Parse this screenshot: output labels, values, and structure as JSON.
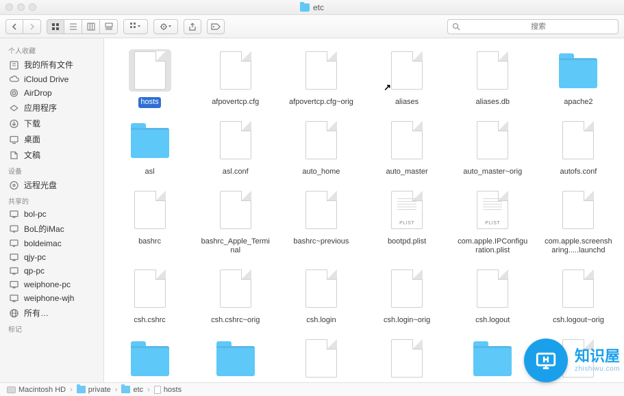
{
  "window": {
    "title": "etc"
  },
  "toolbar": {
    "search_placeholder": "搜索"
  },
  "sidebar": {
    "sections": [
      {
        "header": "个人收藏",
        "items": [
          {
            "icon": "all-files",
            "label": "我的所有文件"
          },
          {
            "icon": "cloud",
            "label": "iCloud Drive"
          },
          {
            "icon": "airdrop",
            "label": "AirDrop"
          },
          {
            "icon": "apps",
            "label": "应用程序"
          },
          {
            "icon": "download",
            "label": "下载"
          },
          {
            "icon": "desktop",
            "label": "桌面"
          },
          {
            "icon": "documents",
            "label": "文稿"
          }
        ]
      },
      {
        "header": "设备",
        "items": [
          {
            "icon": "disc",
            "label": "远程光盘"
          }
        ]
      },
      {
        "header": "共享的",
        "items": [
          {
            "icon": "pc",
            "label": "bol-pc"
          },
          {
            "icon": "imac",
            "label": "BoL的iMac"
          },
          {
            "icon": "imac",
            "label": "boldeimac"
          },
          {
            "icon": "pc",
            "label": "qjy-pc"
          },
          {
            "icon": "pc",
            "label": "qp-pc"
          },
          {
            "icon": "pc",
            "label": "weiphone-pc"
          },
          {
            "icon": "pc",
            "label": "weiphone-wjh"
          },
          {
            "icon": "globe",
            "label": "所有…"
          }
        ]
      },
      {
        "header": "标记",
        "items": []
      }
    ]
  },
  "files": [
    {
      "name": "hosts",
      "type": "file",
      "selected": true
    },
    {
      "name": "afpovertcp.cfg",
      "type": "file"
    },
    {
      "name": "afpovertcp.cfg~orig",
      "type": "file"
    },
    {
      "name": "aliases",
      "type": "file",
      "alias": true
    },
    {
      "name": "aliases.db",
      "type": "file"
    },
    {
      "name": "apache2",
      "type": "folder"
    },
    {
      "name": "asl",
      "type": "folder"
    },
    {
      "name": "asl.conf",
      "type": "file"
    },
    {
      "name": "auto_home",
      "type": "file"
    },
    {
      "name": "auto_master",
      "type": "file"
    },
    {
      "name": "auto_master~orig",
      "type": "file"
    },
    {
      "name": "autofs.conf",
      "type": "file"
    },
    {
      "name": "bashrc",
      "type": "file"
    },
    {
      "name": "bashrc_Apple_Terminal",
      "type": "file"
    },
    {
      "name": "bashrc~previous",
      "type": "file"
    },
    {
      "name": "bootpd.plist",
      "type": "file",
      "tag": "PLIST",
      "lines": true
    },
    {
      "name": "com.apple.IPConfiguration.plist",
      "type": "file",
      "tag": "PLIST",
      "lines": true
    },
    {
      "name": "com.apple.screensharing.....launchd",
      "type": "file"
    },
    {
      "name": "csh.cshrc",
      "type": "file"
    },
    {
      "name": "csh.cshrc~orig",
      "type": "file"
    },
    {
      "name": "csh.login",
      "type": "file"
    },
    {
      "name": "csh.login~orig",
      "type": "file"
    },
    {
      "name": "csh.logout",
      "type": "file"
    },
    {
      "name": "csh.logout~orig",
      "type": "file"
    },
    {
      "name": "",
      "type": "folder"
    },
    {
      "name": "",
      "type": "folder"
    },
    {
      "name": "",
      "type": "file"
    },
    {
      "name": "",
      "type": "file"
    },
    {
      "name": "",
      "type": "folder"
    },
    {
      "name": "",
      "type": "file"
    }
  ],
  "path": [
    {
      "icon": "disk",
      "label": "Macintosh HD"
    },
    {
      "icon": "folder",
      "label": "private"
    },
    {
      "icon": "folder",
      "label": "etc"
    },
    {
      "icon": "file",
      "label": "hosts"
    }
  ],
  "watermark": {
    "big": "知识屋",
    "small": "zhishiwu.com"
  }
}
